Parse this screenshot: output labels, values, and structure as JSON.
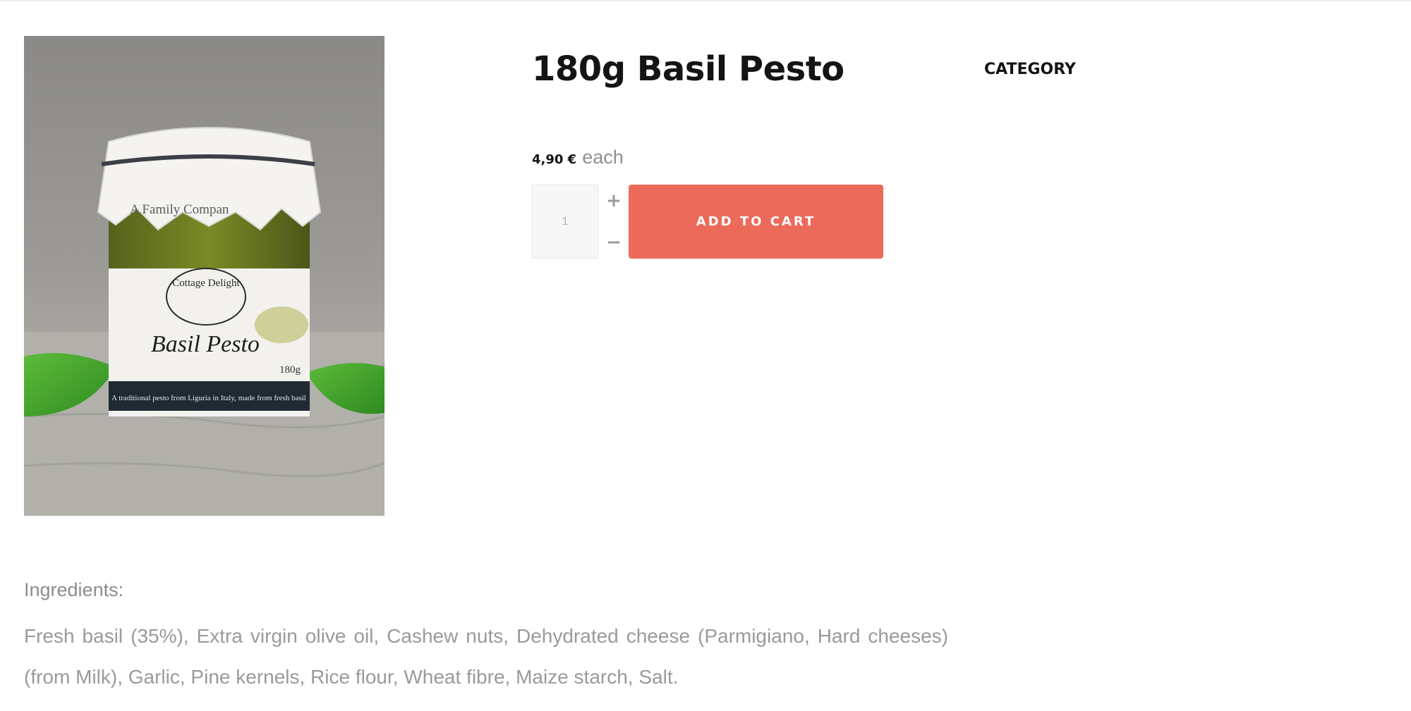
{
  "product": {
    "title": "180g Basil Pesto",
    "category_label": "CATEGORY",
    "price": "4,90 €",
    "unit": "each",
    "quantity": "1",
    "add_to_cart_label": "ADD TO CART",
    "image": {
      "jar_band_text": "A Family Compan",
      "brand": "Cottage Delight",
      "label_name": "Basil Pesto",
      "weight": "180g",
      "strapline": "A traditional pesto from Liguria in Italy, made from fresh basil"
    }
  },
  "ingredients": {
    "heading": "Ingredients:",
    "text": "Fresh basil (35%), Extra virgin olive oil, Cashew nuts, Dehydrated cheese (Parmigiano, Hard cheeses) (from Milk), Garlic, Pine kernels, Rice flour, Wheat fibre, Maize starch, Salt."
  },
  "colors": {
    "accent": "#ec6a5a",
    "title": "#141414",
    "muted_text": "#9a9a9a"
  },
  "icons": {
    "plus": "+",
    "minus": "−"
  }
}
